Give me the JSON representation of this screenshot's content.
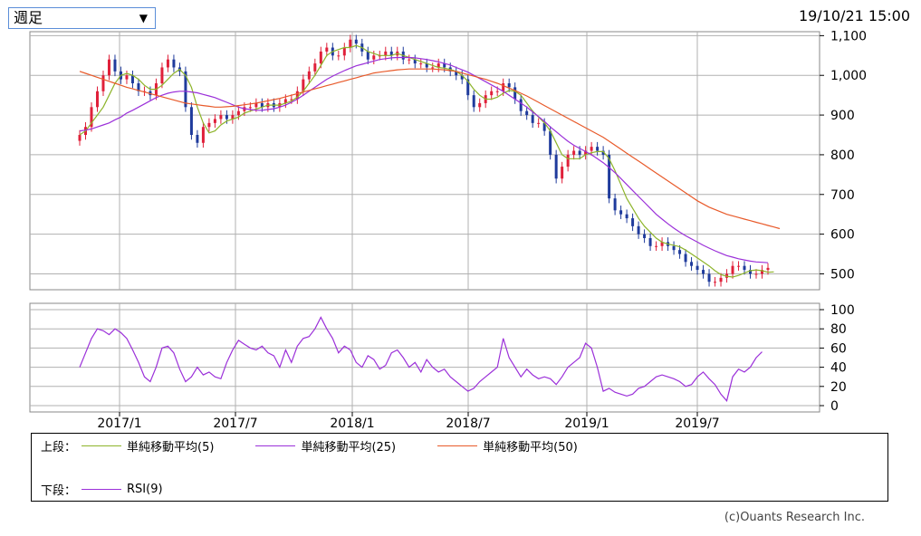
{
  "header": {
    "period_select": "週足",
    "timestamp": "19/10/21 15:00"
  },
  "legend": {
    "upper_label": "上段：",
    "lower_label": "下段：",
    "items_upper": [
      {
        "label": "単純移動平均(5)",
        "color": "#8db42a"
      },
      {
        "label": "単純移動平均(25)",
        "color": "#9b30d9"
      },
      {
        "label": "単純移動平均(50)",
        "color": "#e85a2a"
      }
    ],
    "items_lower": [
      {
        "label": "RSI(9)",
        "color": "#9b30d9"
      }
    ]
  },
  "credit": "(c)Ouants Research Inc.",
  "colors": {
    "up": "#e0203a",
    "down": "#1f3b9c",
    "grid": "#b0b0b0"
  },
  "chart_data": [
    {
      "type": "candlestick",
      "x_ticks": [
        "2017/1",
        "2017/7",
        "2018/1",
        "2018/7",
        "2019/1",
        "2019/7"
      ],
      "ylim": [
        460,
        1110
      ],
      "y_ticks": [
        500,
        600,
        700,
        800,
        900,
        1000,
        1100
      ],
      "y_tick_labels": [
        "500",
        "600",
        "700",
        "800",
        "900",
        "1,000",
        "1,100"
      ],
      "grid": true,
      "close": [
        850,
        870,
        920,
        960,
        1000,
        1040,
        1010,
        990,
        1000,
        980,
        960,
        960,
        950,
        980,
        1020,
        1040,
        1020,
        1010,
        920,
        850,
        830,
        870,
        880,
        890,
        900,
        890,
        900,
        910,
        920,
        920,
        930,
        920,
        930,
        920,
        930,
        940,
        940,
        960,
        990,
        1010,
        1030,
        1060,
        1070,
        1050,
        1050,
        1070,
        1090,
        1080,
        1060,
        1040,
        1050,
        1050,
        1060,
        1050,
        1060,
        1040,
        1040,
        1030,
        1030,
        1020,
        1020,
        1030,
        1020,
        1010,
        1000,
        990,
        950,
        920,
        930,
        950,
        960,
        960,
        980,
        970,
        940,
        910,
        900,
        880,
        880,
        860,
        800,
        740,
        770,
        800,
        810,
        800,
        810,
        820,
        810,
        800,
        690,
        660,
        650,
        640,
        620,
        600,
        590,
        570,
        570,
        580,
        570,
        560,
        550,
        530,
        520,
        510,
        500,
        480,
        480,
        490,
        500,
        520,
        520,
        510,
        500,
        500,
        510,
        515
      ],
      "series": [
        {
          "name": "単純移動平均(5)",
          "values": [
            850,
            860,
            880,
            900,
            920,
            950,
            980,
            1000,
            1005,
            1000,
            990,
            975,
            965,
            965,
            975,
            990,
            1005,
            1015,
            1000,
            970,
            920,
            880,
            855,
            860,
            875,
            885,
            890,
            895,
            905,
            910,
            915,
            920,
            925,
            925,
            925,
            930,
            935,
            945,
            960,
            980,
            1000,
            1025,
            1050,
            1060,
            1065,
            1070,
            1070,
            1075,
            1070,
            1060,
            1055,
            1050,
            1050,
            1050,
            1055,
            1050,
            1045,
            1040,
            1035,
            1030,
            1025,
            1020,
            1018,
            1015,
            1010,
            1000,
            985,
            965,
            950,
            940,
            940,
            945,
            955,
            962,
            960,
            950,
            930,
            910,
            895,
            880,
            860,
            830,
            800,
            790,
            790,
            790,
            800,
            805,
            808,
            808,
            790,
            760,
            725,
            690,
            665,
            640,
            620,
            605,
            590,
            580,
            575,
            572,
            568,
            560,
            550,
            540,
            530,
            520,
            508,
            498,
            494,
            492,
            496,
            502,
            508,
            510,
            508,
            504,
            505
          ]
        },
        {
          "name": "単純移動平均(25)",
          "values": [
            860,
            862,
            865,
            870,
            875,
            880,
            888,
            895,
            905,
            912,
            920,
            928,
            936,
            944,
            950,
            955,
            958,
            960,
            960,
            958,
            956,
            952,
            948,
            944,
            938,
            932,
            926,
            920,
            916,
            914,
            912,
            912,
            914,
            916,
            920,
            925,
            932,
            940,
            950,
            960,
            970,
            980,
            990,
            998,
            1005,
            1012,
            1018,
            1024,
            1028,
            1032,
            1036,
            1040,
            1042,
            1044,
            1045,
            1045,
            1045,
            1044,
            1042,
            1040,
            1037,
            1034,
            1030,
            1026,
            1020,
            1014,
            1008,
            1000,
            992,
            984,
            976,
            968,
            960,
            950,
            940,
            930,
            920,
            908,
            896,
            884,
            870,
            858,
            846,
            834,
            824,
            816,
            808,
            800,
            790,
            780,
            768,
            755,
            740,
            725,
            710,
            695,
            680,
            665,
            650,
            638,
            626,
            615,
            605,
            596,
            588,
            580,
            572,
            565,
            558,
            552,
            546,
            542,
            538,
            535,
            532,
            530,
            529,
            528
          ]
        },
        {
          "name": "単純移動平均(50)",
          "values": [
            1010,
            1005,
            1000,
            995,
            990,
            985,
            980,
            975,
            970,
            966,
            962,
            958,
            954,
            950,
            946,
            942,
            938,
            934,
            930,
            928,
            926,
            924,
            922,
            920,
            920,
            921,
            922,
            924,
            926,
            928,
            930,
            933,
            936,
            939,
            942,
            946,
            950,
            954,
            958,
            962,
            966,
            970,
            974,
            978,
            982,
            986,
            990,
            994,
            998,
            1002,
            1006,
            1008,
            1010,
            1012,
            1014,
            1015,
            1016,
            1016,
            1016,
            1016,
            1016,
            1015,
            1014,
            1012,
            1010,
            1006,
            1002,
            998,
            994,
            990,
            985,
            980,
            974,
            968,
            962,
            955,
            948,
            940,
            932,
            924,
            916,
            908,
            900,
            892,
            884,
            876,
            868,
            860,
            852,
            844,
            834,
            824,
            814,
            804,
            794,
            784,
            774,
            764,
            754,
            744,
            734,
            724,
            714,
            704,
            694,
            684,
            676,
            668,
            662,
            656,
            650,
            646,
            642,
            638,
            634,
            630,
            626,
            622,
            618,
            614
          ]
        }
      ]
    },
    {
      "type": "line",
      "ylim": [
        0,
        100
      ],
      "y_ticks": [
        0,
        20,
        40,
        60,
        80,
        100
      ],
      "grid": true,
      "series": [
        {
          "name": "RSI(9)",
          "values": [
            40,
            55,
            70,
            80,
            78,
            74,
            80,
            76,
            70,
            58,
            45,
            30,
            25,
            40,
            60,
            62,
            55,
            38,
            25,
            30,
            40,
            32,
            35,
            30,
            28,
            45,
            58,
            68,
            64,
            60,
            58,
            62,
            55,
            52,
            40,
            58,
            45,
            62,
            70,
            72,
            80,
            92,
            80,
            70,
            55,
            62,
            58,
            45,
            40,
            52,
            48,
            38,
            42,
            55,
            58,
            50,
            40,
            45,
            35,
            48,
            40,
            35,
            38,
            30,
            25,
            20,
            15,
            18,
            25,
            30,
            35,
            40,
            70,
            50,
            40,
            30,
            38,
            32,
            28,
            30,
            28,
            22,
            30,
            40,
            45,
            50,
            65,
            60,
            40,
            15,
            18,
            14,
            12,
            10,
            12,
            18,
            20,
            25,
            30,
            32,
            30,
            28,
            25,
            20,
            22,
            30,
            35,
            28,
            22,
            12,
            5,
            30,
            38,
            35,
            40,
            50,
            56
          ]
        }
      ]
    }
  ]
}
